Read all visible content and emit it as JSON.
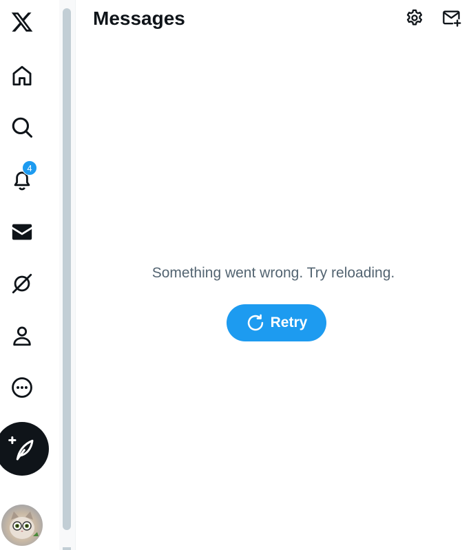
{
  "nav": {
    "items": [
      {
        "name": "x-logo-icon"
      },
      {
        "name": "home-icon"
      },
      {
        "name": "search-icon"
      },
      {
        "name": "notifications-icon",
        "badge": "4"
      },
      {
        "name": "messages-icon"
      },
      {
        "name": "grok-icon"
      },
      {
        "name": "profile-icon"
      },
      {
        "name": "more-icon"
      }
    ],
    "post_button": {
      "name": "compose-post-icon"
    },
    "avatar": {
      "name": "avatar"
    }
  },
  "header": {
    "title": "Messages",
    "settings_icon": "gear-icon",
    "new_message_icon": "new-message-icon"
  },
  "error": {
    "message": "Something went wrong. Try reloading.",
    "retry_label": "Retry",
    "retry_icon": "refresh-icon"
  },
  "colors": {
    "accent": "#1d9bf0",
    "text_primary": "#0f1419",
    "text_secondary": "#536471",
    "scrollbar": "#c2ced5"
  }
}
